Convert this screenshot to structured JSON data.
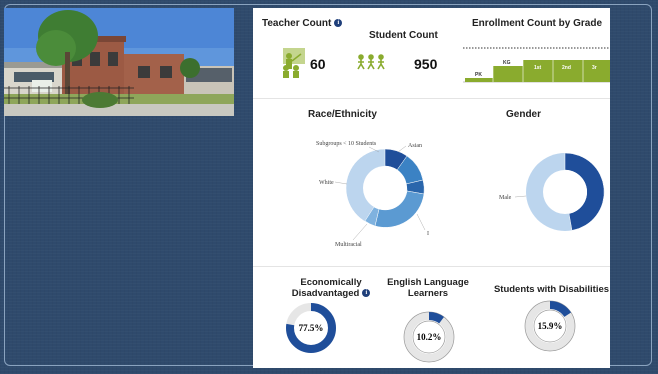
{
  "header": {
    "teacher_count_label": "Teacher Count",
    "student_count_label": "Student Count",
    "enrollment_label": "Enrollment Count by Grade"
  },
  "teacher_count": "60",
  "student_count": "950",
  "icons": {
    "info": "info-icon",
    "teacher": "teacher-icon",
    "students": "students-icon",
    "school_photo": "school-building-photo"
  },
  "colors": {
    "green": "#8aab2e",
    "dark_blue": "#1f4e9a",
    "mid_blue": "#3b82c4",
    "light_blue": "#bcd5ee",
    "ring_gray": "#e6e6e6"
  },
  "enrollment_grades": [
    "PK",
    "KG",
    "1st",
    "2nd",
    "3r"
  ],
  "sections": {
    "race_title": "Race/Ethnicity",
    "gender_title": "Gender",
    "econ_title_line1": "Economically",
    "econ_title_line2": "Disadvantaged",
    "ell_title_line1": "English Language",
    "ell_title_line2": "Learners",
    "swd_title": "Students with Disabilities"
  },
  "race_labels": {
    "subgroups": "Subgroups < 10 Students",
    "asian": "Asian",
    "white": "White",
    "multiracial": "Multiracial",
    "other": "I"
  },
  "gender_labels": {
    "male": "Male"
  },
  "stats": {
    "econ": {
      "label": "77.5%",
      "value": 0.775
    },
    "ell": {
      "label": "10.2%",
      "value": 0.102
    },
    "swd": {
      "label": "15.9%",
      "value": 0.159
    }
  }
}
